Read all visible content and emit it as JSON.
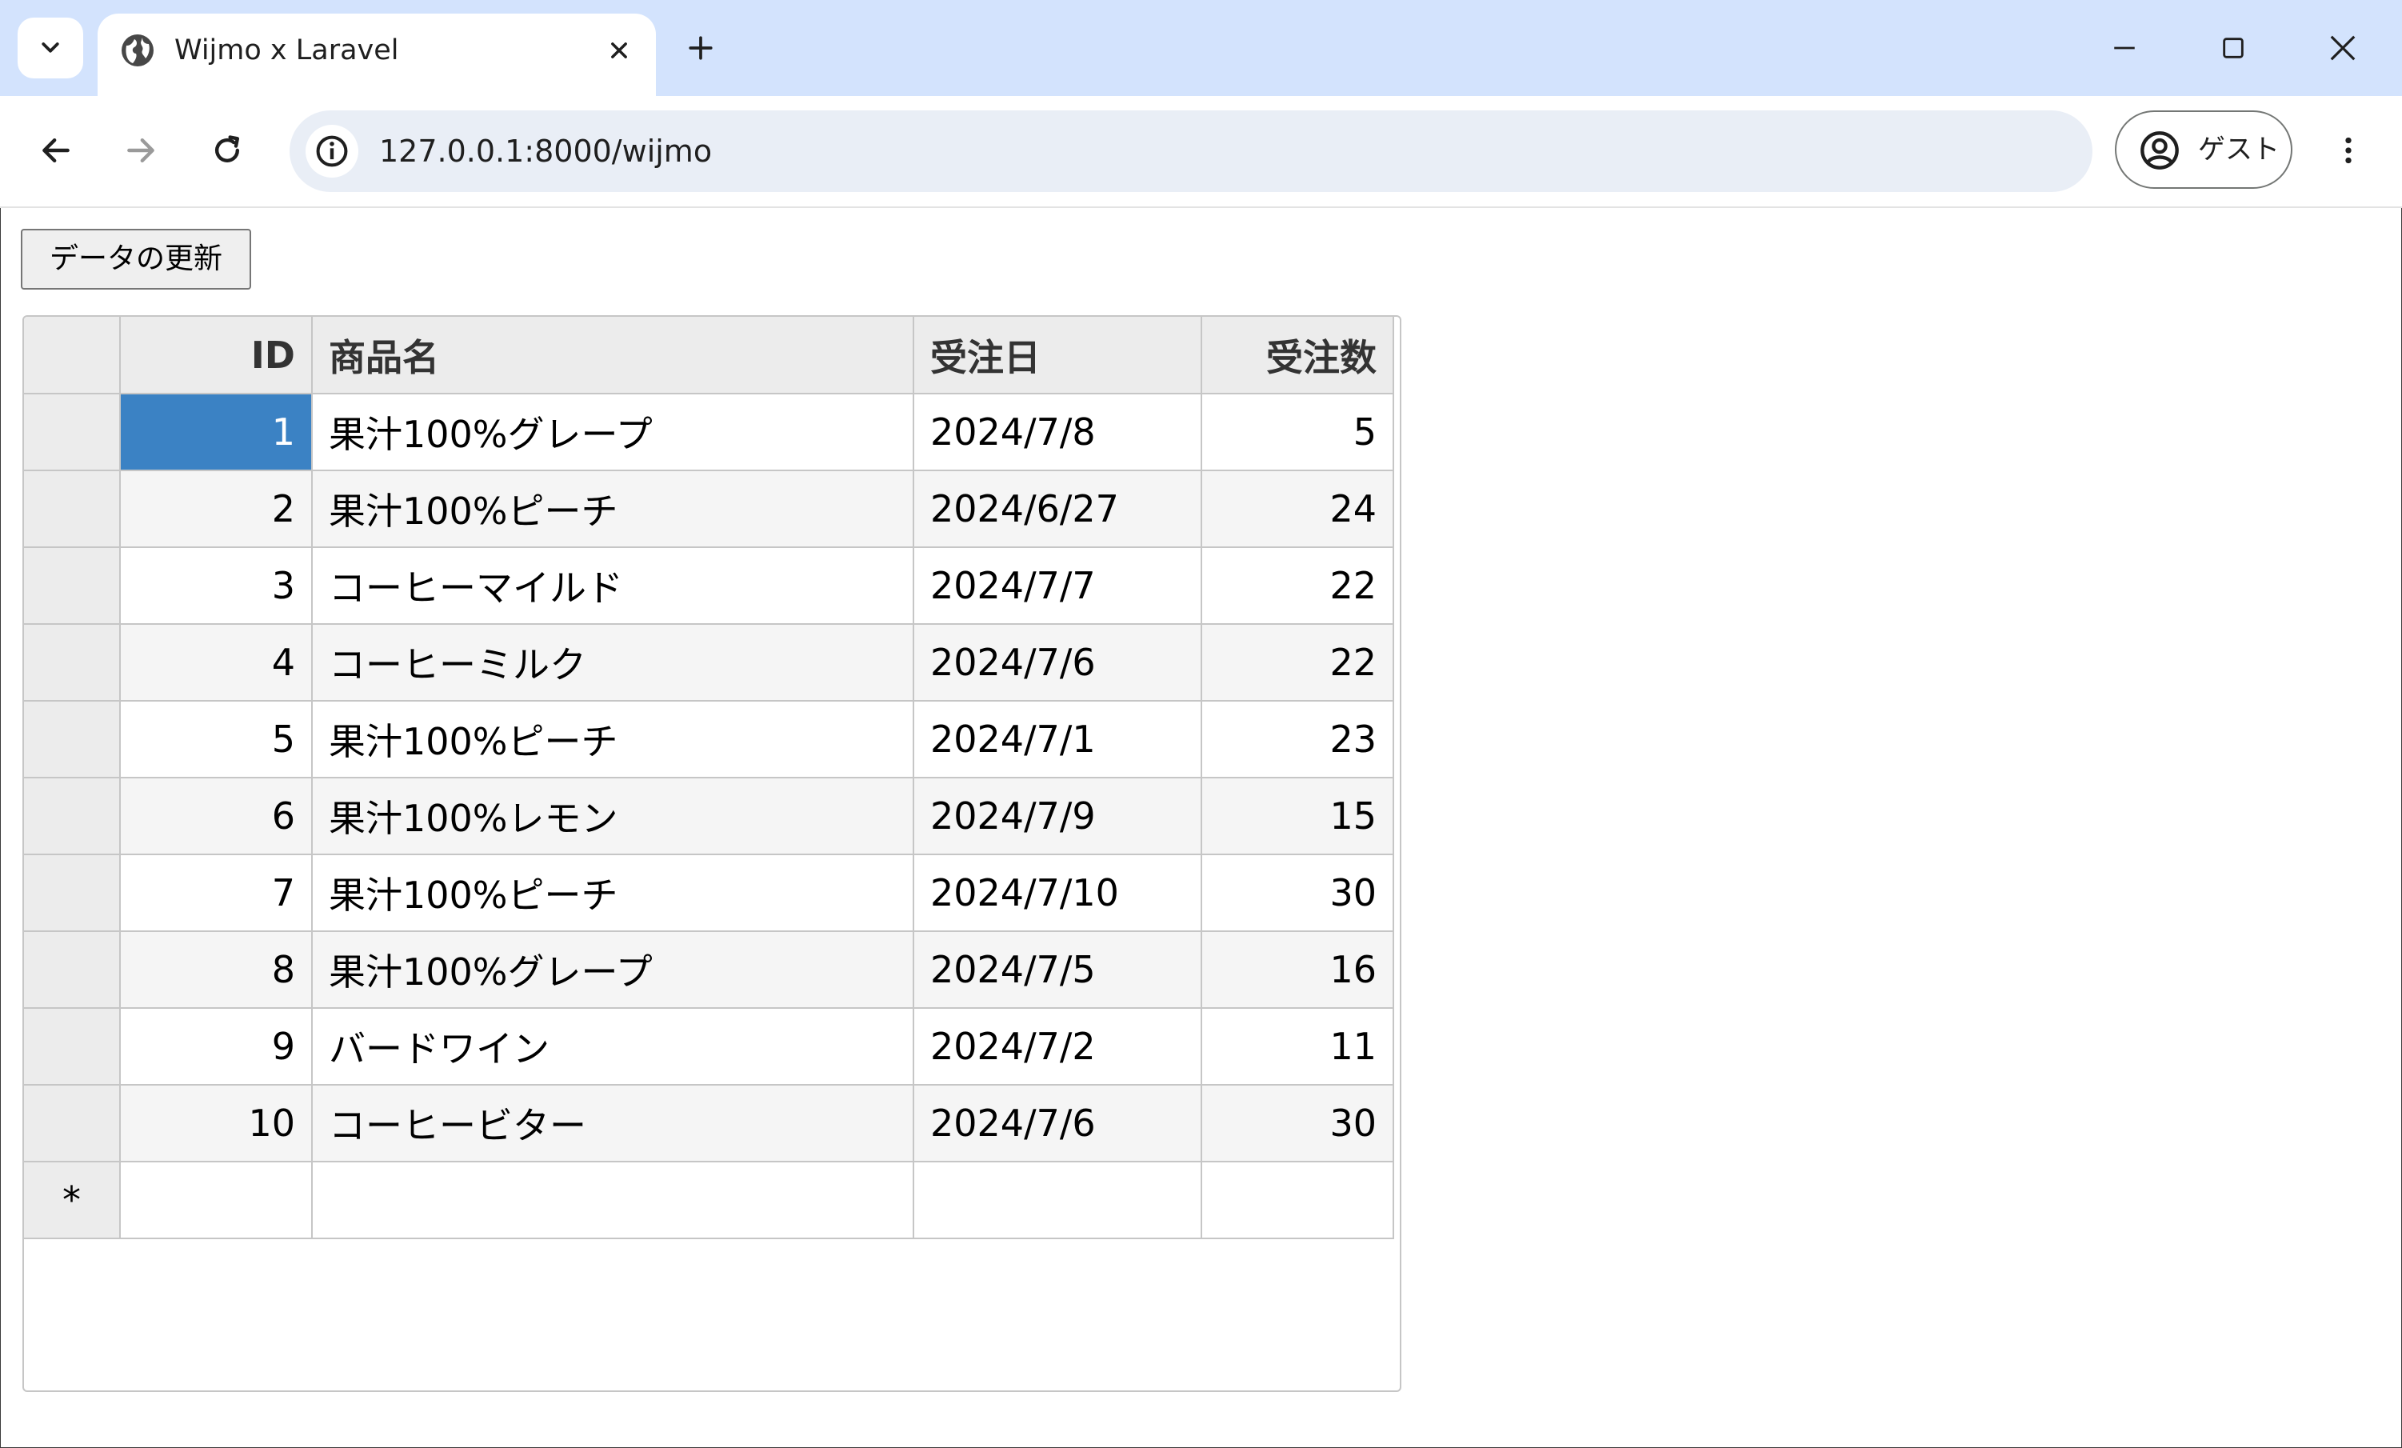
{
  "browser": {
    "tab_title": "Wijmo x Laravel",
    "url": "127.0.0.1:8000/wijmo",
    "profile_label": "ゲスト"
  },
  "page": {
    "refresh_button_label": "データの更新"
  },
  "grid": {
    "columns": [
      "ID",
      "商品名",
      "受注日",
      "受注数"
    ],
    "rows": [
      {
        "id": "1",
        "name": "果汁100%グレープ",
        "date": "2024/7/8",
        "qty": "5"
      },
      {
        "id": "2",
        "name": "果汁100%ピーチ",
        "date": "2024/6/27",
        "qty": "24"
      },
      {
        "id": "3",
        "name": "コーヒーマイルド",
        "date": "2024/7/7",
        "qty": "22"
      },
      {
        "id": "4",
        "name": "コーヒーミルク",
        "date": "2024/7/6",
        "qty": "22"
      },
      {
        "id": "5",
        "name": "果汁100%ピーチ",
        "date": "2024/7/1",
        "qty": "23"
      },
      {
        "id": "6",
        "name": "果汁100%レモン",
        "date": "2024/7/9",
        "qty": "15"
      },
      {
        "id": "7",
        "name": "果汁100%ピーチ",
        "date": "2024/7/10",
        "qty": "30"
      },
      {
        "id": "8",
        "name": "果汁100%グレープ",
        "date": "2024/7/5",
        "qty": "16"
      },
      {
        "id": "9",
        "name": "バードワイン",
        "date": "2024/7/2",
        "qty": "11"
      },
      {
        "id": "10",
        "name": "コーヒービター",
        "date": "2024/7/6",
        "qty": "30"
      }
    ],
    "new_row_marker": "*",
    "selected_color": "#3b82c4"
  },
  "icons": {
    "tab_search": "chevron-down-icon",
    "tab_favicon": "globe-icon",
    "tab_close": "close-icon",
    "new_tab": "plus-icon",
    "minimize": "minimize-icon",
    "maximize": "maximize-icon",
    "close_window": "close-icon",
    "back": "arrow-left-icon",
    "forward": "arrow-right-icon",
    "reload": "reload-icon",
    "site_info": "info-icon",
    "profile": "account-circle-icon",
    "menu": "kebab-menu-icon"
  }
}
